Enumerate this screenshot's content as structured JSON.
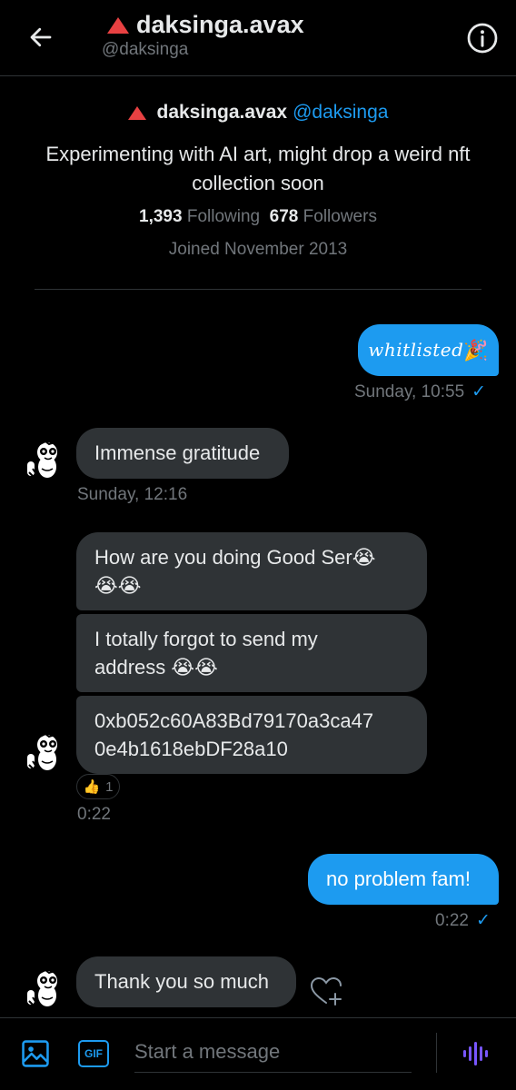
{
  "header": {
    "display_name": "daksinga.avax",
    "handle": "@daksinga",
    "icons": {
      "back": "arrow-left-icon",
      "info": "info-circle-icon",
      "badge": "avalanche-triangle-icon"
    }
  },
  "profile": {
    "display_name": "daksinga.avax",
    "handle": "@daksinga",
    "bio": "Experimenting with AI art, might drop a weird nft collection soon",
    "following_count": "1,393",
    "following_label": "Following",
    "followers_count": "678",
    "followers_label": "Followers",
    "joined": "Joined November 2013"
  },
  "messages": [
    {
      "from": "me",
      "text": "whitlisted",
      "emoji": "🎉",
      "time": "Sunday, 10:55",
      "read": true
    },
    {
      "from": "them",
      "text": "Immense gratitude",
      "time": "Sunday, 12:16"
    },
    {
      "from": "them",
      "text": "How are you doing Good Ser",
      "emoji1": "😭",
      "emoji_line2": "😭😭"
    },
    {
      "from": "them",
      "text": "I totally forgot to send my",
      "text_line2": "address",
      "emoji": "😭😭"
    },
    {
      "from": "them",
      "text": "0xb052c60A83Bd79170a3ca47",
      "text_line2": "0e4b1618ebDF28a10",
      "reaction": {
        "emoji": "👍",
        "count": "1"
      },
      "time": "0:22"
    },
    {
      "from": "me",
      "text": "no problem fam!",
      "time": "0:22",
      "read": true
    },
    {
      "from": "them",
      "text": "Thank you so much"
    }
  ],
  "read_check": "✓",
  "composer": {
    "placeholder": "Start a message",
    "gif_label": "GIF",
    "icons": {
      "image": "image-icon",
      "gif": "gif-icon",
      "voice": "voice-waveform-icon",
      "react": "heart-plus-icon"
    }
  },
  "colors": {
    "accent": "#1d9bf0",
    "bubble_received": "#2f3336",
    "avax_red": "#e84142",
    "background": "#000000"
  }
}
